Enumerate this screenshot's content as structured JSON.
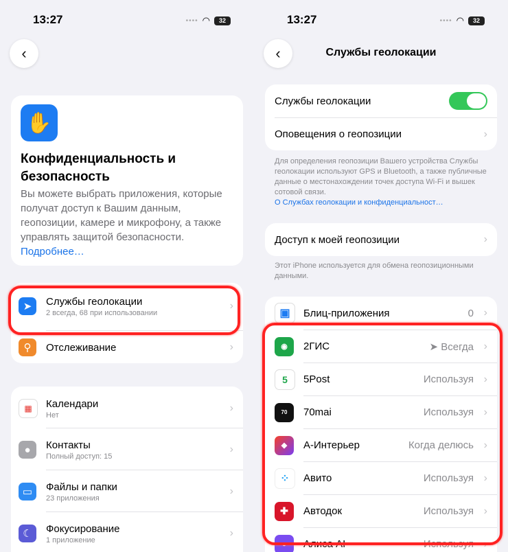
{
  "left": {
    "status_time": "13:27",
    "battery": "32",
    "hero": {
      "title": "Конфиденциальность и безопасность",
      "description": "Вы можете выбрать приложения, которые получат доступ к Вашим данным, геопозиции, камере и микрофону, а также управлять защитой безопасности.",
      "more_link": "Подробнее…"
    },
    "group1": [
      {
        "title": "Службы геолокации",
        "subtitle": "2 всегда, 68 при использовании",
        "icon": "location-arrow-icon",
        "color": "#1d7cf2"
      },
      {
        "title": "Отслеживание",
        "subtitle": "",
        "icon": "tracking-icon",
        "color": "#f08a2c"
      }
    ],
    "group2": [
      {
        "title": "Календари",
        "subtitle": "Нет",
        "icon": "calendar-icon",
        "color": "#ffffff"
      },
      {
        "title": "Контакты",
        "subtitle": "Полный доступ: 15",
        "icon": "contacts-icon",
        "color": "#9a9a9e"
      },
      {
        "title": "Файлы и папки",
        "subtitle": "23 приложения",
        "icon": "folder-icon",
        "color": "#2f8cf3"
      },
      {
        "title": "Фокусирование",
        "subtitle": "1 приложение",
        "icon": "moon-icon",
        "color": "#5b5bd6"
      }
    ]
  },
  "right": {
    "status_time": "13:27",
    "battery": "32",
    "nav_title": "Службы геолокации",
    "main_toggle_label": "Службы геолокации",
    "alerts_label": "Оповещения о геопозиции",
    "info_note": "Для определения геопозиции Вашего устройства Службы геолокации используют GPS и Bluetooth, а также публичные данные о местонахождении точек доступа Wi-Fi и вышек сотовой связи.",
    "info_link": "О Службах геолокации и конфиденциальност…",
    "share_label": "Доступ к моей геопозиции",
    "share_note": "Этот iPhone используется для обмена геопозиционными данными.",
    "apps": [
      {
        "name": "Блиц-приложения",
        "value": "0",
        "icon": "app-clips-icon",
        "color": "#1d7cf2"
      },
      {
        "name": "2ГИС",
        "value": "Всегда",
        "icon": "2gis-icon",
        "color": "#1ea64a"
      },
      {
        "name": "5Post",
        "value": "Используя",
        "icon": "5post-icon",
        "color": "#ffffff"
      },
      {
        "name": "70mai",
        "value": "Используя",
        "icon": "70mai-icon",
        "color": "#111111"
      },
      {
        "name": "А-Интерьер",
        "value": "Когда делюсь",
        "icon": "a-interior-icon",
        "color": "#e5302a"
      },
      {
        "name": "Авито",
        "value": "Используя",
        "icon": "avito-icon",
        "color": "#ffffff"
      },
      {
        "name": "Автодок",
        "value": "Используя",
        "icon": "avtodok-icon",
        "color": "#d8152a"
      },
      {
        "name": "Алиса AI",
        "value": "Используя",
        "icon": "alice-icon",
        "color": "#7a4cf0"
      }
    ]
  }
}
